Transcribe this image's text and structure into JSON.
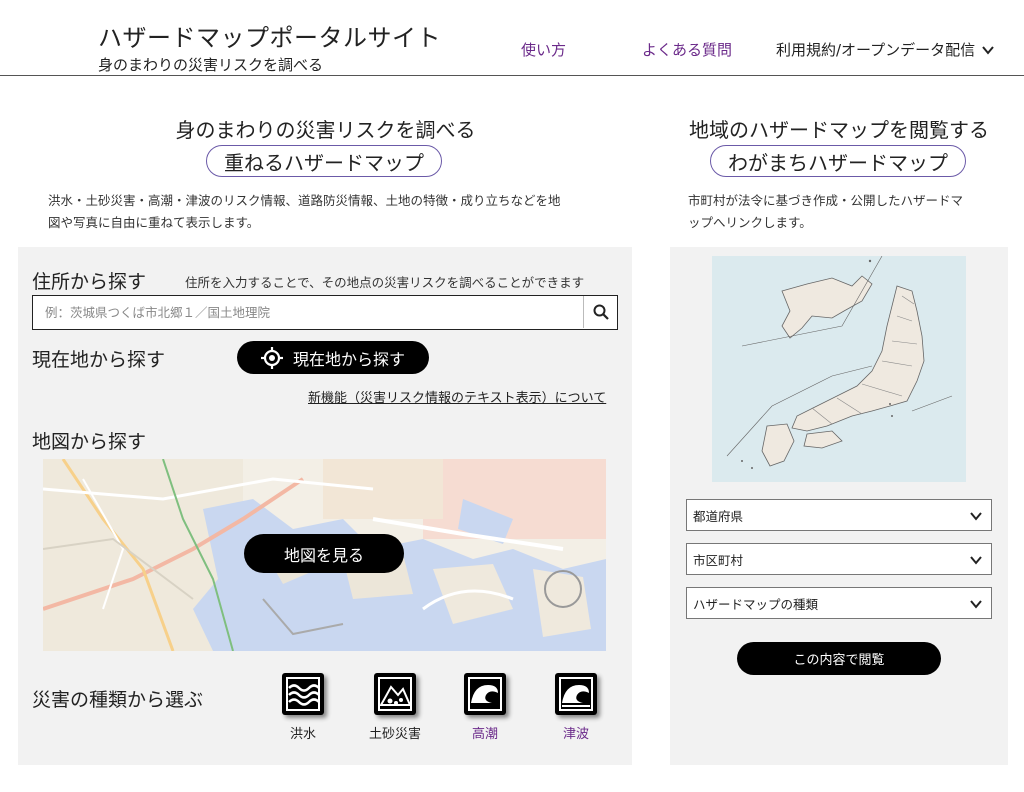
{
  "header": {
    "site_title": "ハザードマップポータルサイト",
    "site_subtitle": "身のまわりの災害リスクを調べる",
    "nav": {
      "howto": "使い方",
      "faq": "よくある質問",
      "terms": "利用規約/オープンデータ配信"
    }
  },
  "left": {
    "title": "身のまわりの災害リスクを調べる",
    "pill": "重ねるハザードマップ",
    "description_line1": "洪水・土砂災害・高潮・津波のリスク情報、道路防災情報、土地の特徴・成り立ちなどを地",
    "description_line2": "図や写真に自由に重ねて表示します。",
    "address_search": {
      "heading": "住所から探す",
      "note": "住所を入力することで、その地点の災害リスクを調べることができます",
      "placeholder": "例：茨城県つくば市北郷１／国土地理院",
      "value": ""
    },
    "current_location": {
      "heading": "現在地から探す",
      "button": "現在地から探す"
    },
    "new_feature_link": "新機能（災害リスク情報のテキスト表示）について",
    "map_search": {
      "heading": "地図から探す",
      "button": "地図を見る"
    },
    "disaster_types": {
      "heading": "災害の種類から選ぶ",
      "items": [
        {
          "label": "洪水",
          "icon": "flood-icon",
          "color": "#222222"
        },
        {
          "label": "土砂災害",
          "icon": "landslide-icon",
          "color": "#222222"
        },
        {
          "label": "高潮",
          "icon": "storm-surge-icon",
          "color": "#6b2a8a"
        },
        {
          "label": "津波",
          "icon": "tsunami-icon",
          "color": "#6b2a8a"
        }
      ]
    }
  },
  "right": {
    "title": "地域のハザードマップを閲覧する",
    "pill": "わがまちハザードマップ",
    "description_line1": "市町村が法令に基づき作成・公開したハザードマ",
    "description_line2": "ップへリンクします。",
    "selects": {
      "prefecture": "都道府県",
      "municipality": "市区町村",
      "map_type": "ハザードマップの種類"
    },
    "view_button": "この内容で閲覧"
  },
  "colors": {
    "accent_purple": "#6b2a8a",
    "pill_border": "#6b5aa8",
    "panel_bg": "#f2f2f2",
    "button_bg": "#000000"
  }
}
